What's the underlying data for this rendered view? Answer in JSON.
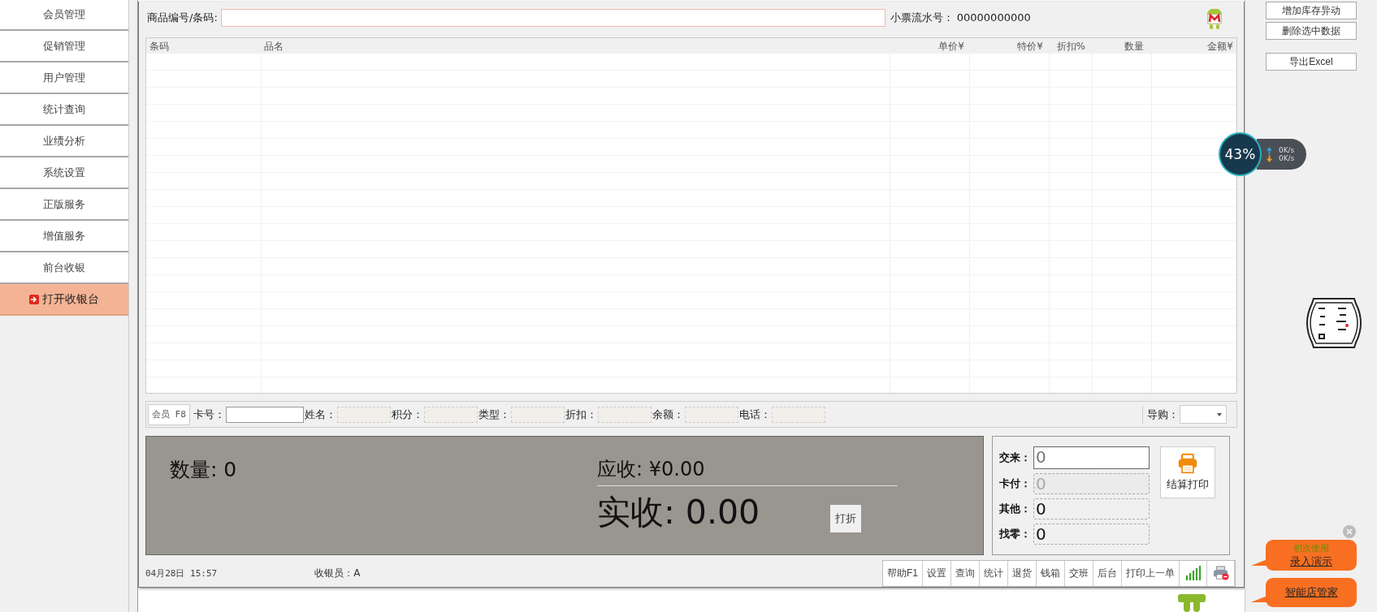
{
  "sidebar": {
    "items": [
      {
        "label": "会员管理",
        "kind": "link",
        "selected": false
      },
      {
        "label": "促销管理",
        "kind": "link",
        "selected": false
      },
      {
        "label": "用户管理",
        "kind": "link",
        "selected": false
      },
      {
        "label": "统计查询",
        "kind": "link",
        "selected": false
      },
      {
        "label": "业绩分析",
        "kind": "link",
        "selected": false
      },
      {
        "label": "系统设置",
        "kind": "link",
        "selected": false
      },
      {
        "label": "正版服务",
        "kind": "link",
        "selected": false
      },
      {
        "label": "增值服务",
        "kind": "link",
        "selected": false
      },
      {
        "label": "前台收银",
        "kind": "link",
        "selected": false
      },
      {
        "label": "打开收银台",
        "kind": "action",
        "selected": true
      }
    ]
  },
  "search": {
    "label": "商品编号/条码:"
  },
  "receipt": {
    "label": "小票流水号：",
    "value": "00000000000"
  },
  "table": {
    "columns": [
      "条码",
      "品名",
      "单价¥",
      "特价¥",
      "折扣%",
      "数量",
      "金额¥"
    ]
  },
  "member_bar": {
    "button": "会员 F8",
    "fields": [
      {
        "label": "卡号：",
        "kind": "input"
      },
      {
        "label": "姓名：",
        "kind": "readonly"
      },
      {
        "label": "积分：",
        "kind": "readonly"
      },
      {
        "label": "类型：",
        "kind": "readonly"
      },
      {
        "label": "折扣：",
        "kind": "readonly"
      },
      {
        "label": "余额：",
        "kind": "readonly"
      },
      {
        "label": "电话：",
        "kind": "readonly"
      }
    ],
    "guide": {
      "label": "导购："
    }
  },
  "summary": {
    "quantity": "数量: 0",
    "receivable": "应收: ¥0.00",
    "received": "实收: 0.00",
    "discount_button": "打折"
  },
  "payment": {
    "fields": [
      {
        "label": "交来：",
        "value": "0",
        "kind": "input",
        "disabled": false
      },
      {
        "label": "卡付：",
        "value": "0",
        "kind": "readonly",
        "disabled": true
      },
      {
        "label": "其他：",
        "value": "0",
        "kind": "readonly",
        "disabled": false
      },
      {
        "label": "找零：",
        "value": "0",
        "kind": "readonly",
        "disabled": false
      }
    ],
    "settle_button": "结算打印"
  },
  "status_bar": {
    "datetime": "04月28日 15:57",
    "cashier": "收银员：A",
    "buttons": [
      {
        "label": "帮助F1",
        "kind": "text"
      },
      {
        "label": "设置",
        "kind": "text"
      },
      {
        "label": "查询",
        "kind": "text"
      },
      {
        "label": "统计",
        "kind": "text"
      },
      {
        "label": "退货",
        "kind": "text"
      },
      {
        "label": "钱箱",
        "kind": "text"
      },
      {
        "label": "交班",
        "kind": "text"
      },
      {
        "label": "后台",
        "kind": "text"
      },
      {
        "label": "打印上一单",
        "kind": "text"
      },
      {
        "kind": "signal"
      },
      {
        "kind": "printer"
      }
    ]
  },
  "right_panel": {
    "buttons": [
      "增加库存异动",
      "删除选中数据",
      "导出Excel"
    ]
  },
  "network_widget": {
    "percent": "43%",
    "upload": "0K/s",
    "download": "0K/s"
  },
  "bubbles": [
    {
      "hint": "初次使用",
      "link": "录入演示"
    },
    {
      "link": "智能店管家"
    }
  ]
}
